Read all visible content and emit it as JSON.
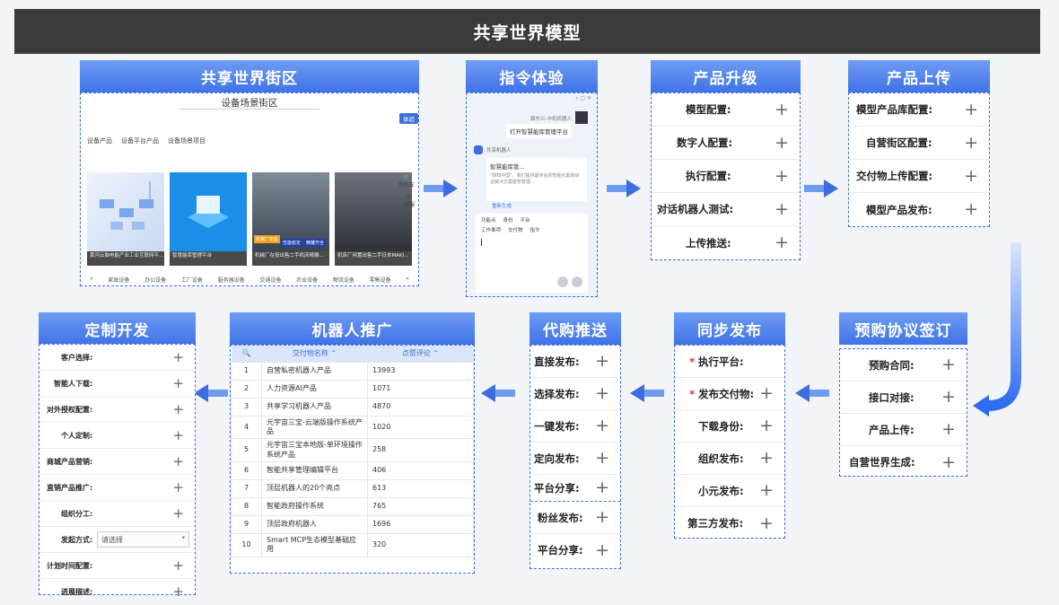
{
  "title": "共享世界模型",
  "street": {
    "header": "共享世界街区",
    "title": "设备场景街区",
    "experience_btn": "体验",
    "tabs": [
      "设备产品",
      "设备平台产品",
      "设备场景项目"
    ],
    "cards": [
      "黄河云脑电能产业工业互联网平...",
      "智慧能库管理平台",
      "机械厂在役出售二手机床精雕...",
      "机床厂闲置出售二手日本MAKI..."
    ],
    "card_tags": [
      "性能稳定",
      "精雕齐全"
    ],
    "side_icons": [
      "购物车",
      "客服"
    ],
    "categories": [
      "家政设备",
      "办公设备",
      "工厂设备",
      "服务器设备",
      "交通设备",
      "农业设备",
      "物流设备",
      "零售设备"
    ]
  },
  "command": {
    "header": "指令体验",
    "user_name": "霸东兴-中机机器人",
    "user_msg": "打开智慧能库管理平台",
    "bot_name": "共享机器人",
    "bot_title": "智慧能库管...",
    "bot_text": "\"感知中国\"，我们提供最专业的智能化能库综合解决方案能管管理...",
    "regen": "重新生成",
    "toolbar1": [
      "功能点",
      "身份",
      "平台"
    ],
    "toolbar2": [
      "工作事项",
      "交付物",
      "指令"
    ]
  },
  "upgrade": {
    "header": "产品升级",
    "items": [
      "模型配置:",
      "数字人配置:",
      "执行配置:",
      "对话机器人测试:",
      "上传推送:"
    ]
  },
  "upload": {
    "header": "产品上传",
    "items": [
      "模型产品库配置:",
      "自营街区配置:",
      "交付物上传配置:",
      "模型产品发布:"
    ]
  },
  "presale": {
    "header": "预购协议签订",
    "items": [
      "预购合同:",
      "接口对接:",
      "产品上传:",
      "自营世界生成:"
    ]
  },
  "sync": {
    "header": "同步发布",
    "items": [
      {
        "label": "执行平台:",
        "required": true,
        "plus": false
      },
      {
        "label": "发布交付物:",
        "required": true,
        "plus": true
      },
      {
        "label": "下载身份:",
        "required": false,
        "plus": true
      },
      {
        "label": "组织发布:",
        "required": false,
        "plus": true
      },
      {
        "label": "小元发布:",
        "required": false,
        "plus": true
      },
      {
        "label": "第三方发布:",
        "required": false,
        "plus": true
      }
    ]
  },
  "proxy": {
    "header": "代购推送",
    "items": [
      "直接发布:",
      "选择发布:",
      "一键发布:",
      "定向发布:",
      "平台分享:",
      "粉丝发布:",
      "平台分享:"
    ]
  },
  "robot": {
    "header": "机器人推广",
    "columns": [
      "交付物名称",
      "点赞评论"
    ],
    "rows": [
      [
        "1",
        "自营私密机器人产品",
        "13993"
      ],
      [
        "2",
        "人力资源AI产品",
        "1071"
      ],
      [
        "3",
        "共享学习机器人产品",
        "4870"
      ],
      [
        "4",
        "元宇宙三宝-云端版操作系统产品",
        "1020"
      ],
      [
        "5",
        "元宇宙三宝本地版-单环境操作系统产品",
        "258"
      ],
      [
        "6",
        "智能共享管理编辑平台",
        "406"
      ],
      [
        "7",
        "顶层机器人的20个亮点",
        "613"
      ],
      [
        "8",
        "智能政府操作系统",
        "765"
      ],
      [
        "9",
        "顶层政府机器人",
        "1696"
      ],
      [
        "10",
        "Smart MCP生态模型基础应用",
        "320"
      ]
    ]
  },
  "custom": {
    "header": "定制开发",
    "items": [
      "客户选择:",
      "智能人下载:",
      "对外授权配置:",
      "个人定制:",
      "商城产品营销:",
      "直销产品推广:",
      "组织分工:",
      "发起方式:",
      "计划时间配置:",
      "进展描述:"
    ],
    "select_placeholder": "请选择"
  },
  "colors": {
    "accent": "#3d6ee0",
    "topbar": "#3b3b3b",
    "required": "#e02a2a"
  }
}
